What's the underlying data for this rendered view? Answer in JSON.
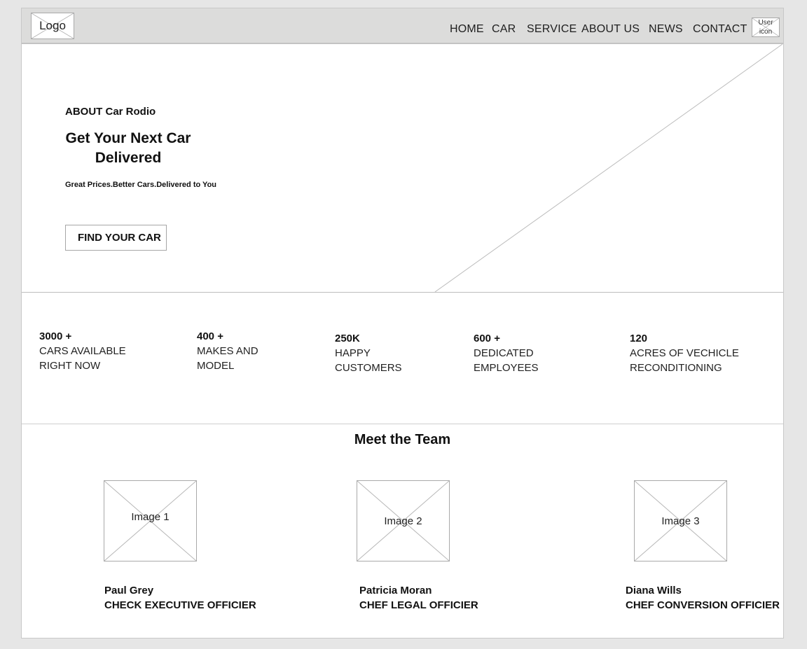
{
  "header": {
    "logo_label": "Logo",
    "nav": [
      "HOME",
      "CAR",
      "SERVICE",
      "ABOUT US",
      "NEWS",
      "CONTACT"
    ],
    "user_icon_label": [
      "User",
      "icon"
    ]
  },
  "hero": {
    "eyebrow": "ABOUT Car Rodio",
    "title": "Get Your Next Car Delivered",
    "subtitle": "Great Prices.Better Cars.Delivered to You",
    "button_label": "FIND YOUR CAR"
  },
  "stats": [
    {
      "number": "3000 +",
      "label": "CARS AVAILABLE\nRIGHT NOW"
    },
    {
      "number": "400 +",
      "label": "MAKES AND\nMODEL"
    },
    {
      "number": "250K",
      "label": "HAPPY\nCUSTOMERS"
    },
    {
      "number": "600 +",
      "label": "DEDICATED\nEMPLOYEES"
    },
    {
      "number": "120",
      "label": "ACRES OF VECHICLE\nRECONDITIONING"
    }
  ],
  "team": {
    "title": "Meet the Team",
    "members": [
      {
        "image_label": "Image 1",
        "name": "Paul Grey",
        "role": "CHECK EXECUTIVE OFFICIER"
      },
      {
        "image_label": "Image 2",
        "name": "Patricia Moran",
        "role": "CHEF LEGAL OFFICIER"
      },
      {
        "image_label": "Image 3",
        "name": "Diana Wills",
        "role": "CHEF CONVERSION OFFICIER"
      }
    ]
  },
  "colors": {
    "page_bg": "#e6e6e6",
    "header_bg": "#dcdcdb",
    "border": "#c3c3c3",
    "text": "#111111"
  }
}
